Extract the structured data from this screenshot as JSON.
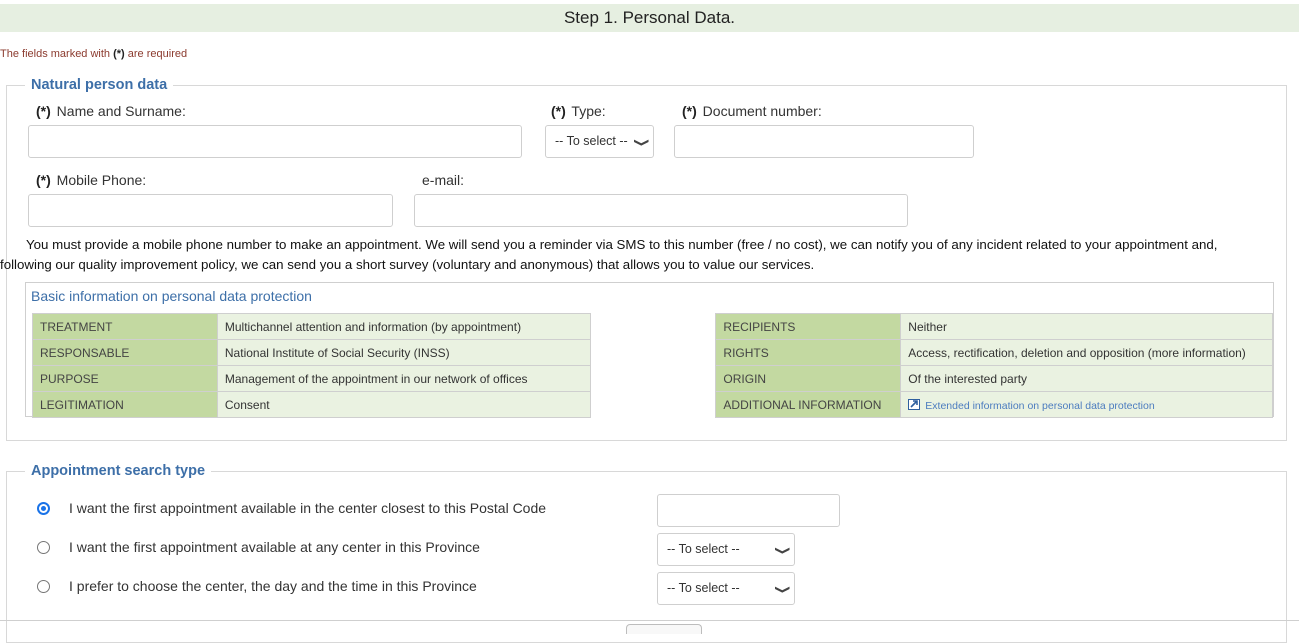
{
  "header": {
    "title": "Step 1. Personal Data."
  },
  "required_note": {
    "prefix": "The fields marked with ",
    "mark": "(*)",
    "suffix": " are required"
  },
  "natural_person": {
    "legend": "Natural person data",
    "required_mark": "(*)",
    "name_label": "Name and Surname:",
    "name_value": "",
    "type_label": "Type:",
    "type_select": "-- To select --",
    "document_label": "Document number:",
    "document_value": "",
    "mobile_label": "Mobile Phone:",
    "mobile_value": "",
    "email_label": "e-mail:",
    "email_value": "",
    "sms_text_line1": "You must provide a mobile phone number to make an appointment. We will send you a reminder via SMS to this number (free / no cost), we can notify you of any incident related to your appointment and,",
    "sms_text_line2": "following our quality improvement policy, we can send you a short survey (voluntary and anonymous) that allows you to value our services."
  },
  "data_protection": {
    "title": "Basic information on personal data protection",
    "left_rows": [
      {
        "key": "TREATMENT",
        "value": "Multichannel attention and information (by appointment)"
      },
      {
        "key": "RESPONSABLE",
        "value": "National Institute of Social Security (INSS)"
      },
      {
        "key": "PURPOSE",
        "value": "Management of the appointment in our network of offices"
      },
      {
        "key": "LEGITIMATION",
        "value": "Consent"
      }
    ],
    "right_rows": [
      {
        "key": "RECIPIENTS",
        "value": "Neither"
      },
      {
        "key": "RIGHTS",
        "value": "Access, rectification, deletion and opposition (more information)"
      },
      {
        "key": "ORIGIN",
        "value": "Of the interested party"
      },
      {
        "key": "ADDITIONAL INFORMATION",
        "value": "Extended information on personal data protection"
      }
    ],
    "link_color": "#4c7cbf"
  },
  "search_type": {
    "legend": "Appointment search type",
    "options": [
      {
        "label": "I want the first appointment available in the center closest to this Postal Code",
        "selected": true,
        "control": "postal-code-input",
        "value": ""
      },
      {
        "label": "I want the first appointment available at any center in this Province",
        "selected": false,
        "control": "select",
        "value": "-- To select --"
      },
      {
        "label": "I prefer to choose the center, the day and the time in this Province",
        "selected": false,
        "control": "select",
        "value": "-- To select --"
      }
    ]
  },
  "colors": {
    "header_bg": "#e6efe1",
    "legend": "#3d6fa8",
    "table_key_bg": "#c3d9a1",
    "table_value_bg": "#eaf2e1",
    "radio_selected": "#1a73e8"
  },
  "icons": {
    "chevron": "chevron-down-icon",
    "external_link": "external-link-icon"
  }
}
